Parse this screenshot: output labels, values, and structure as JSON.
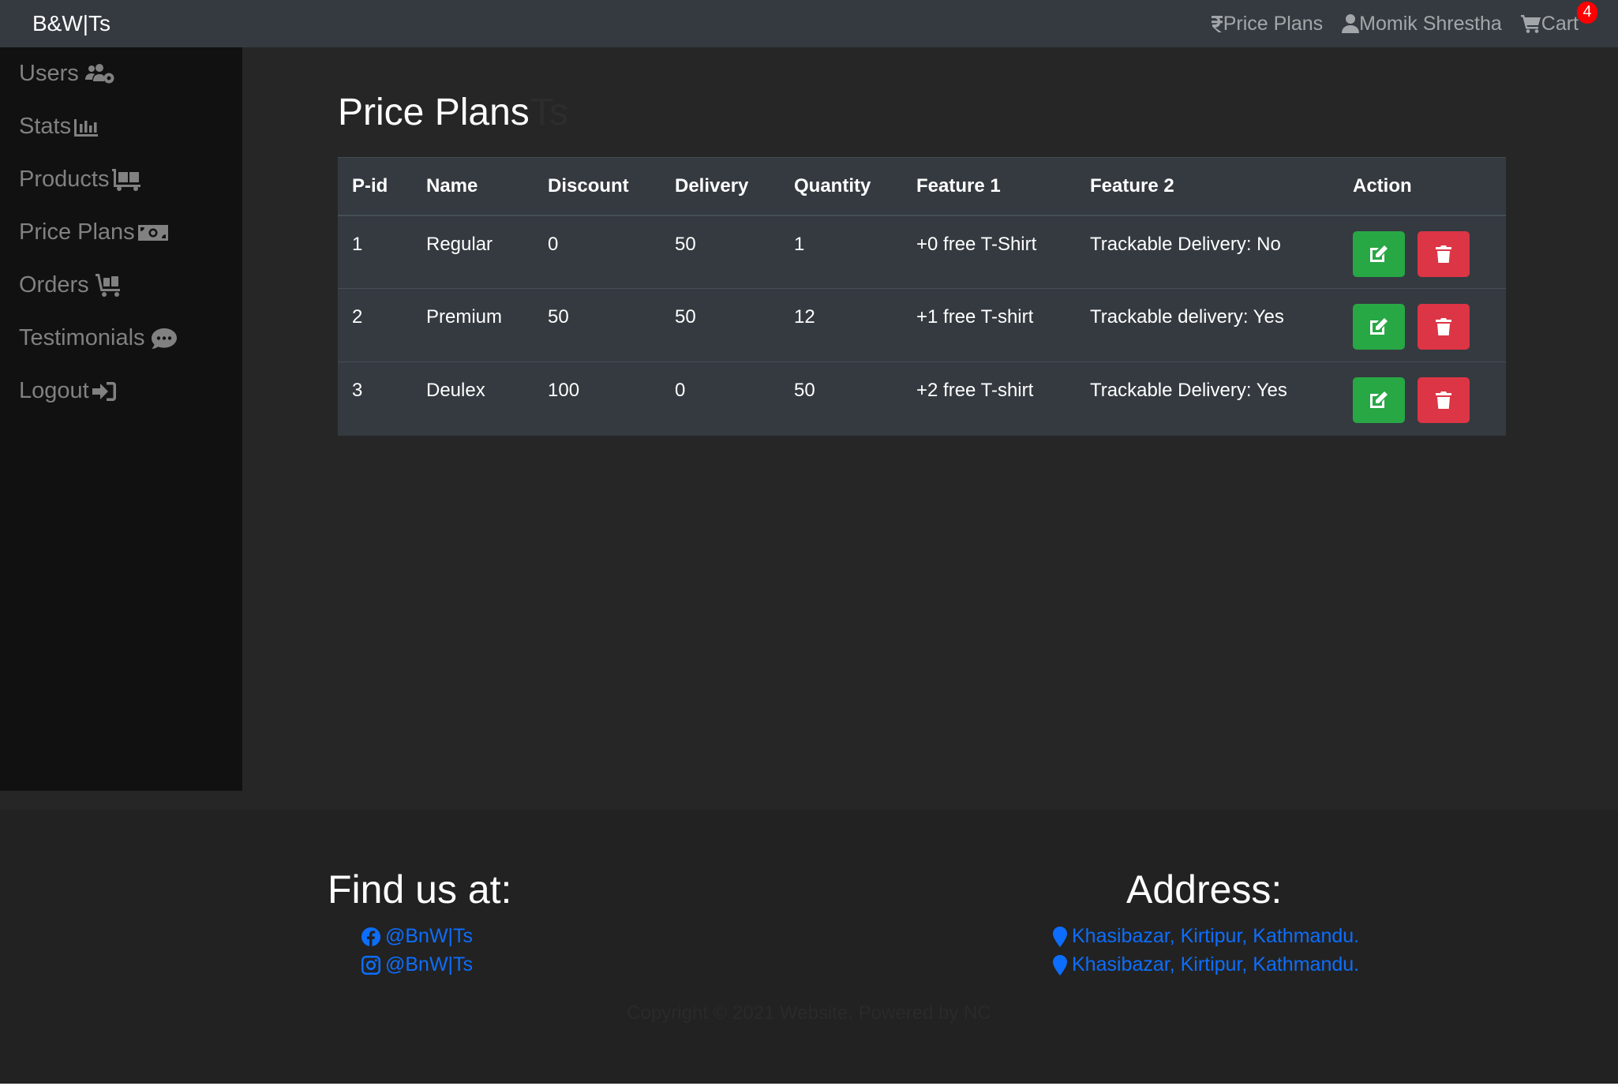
{
  "navbar": {
    "brand": "B&W|Ts",
    "links": {
      "price_plans": "Price Plans",
      "user": "Momik Shrestha",
      "cart": "Cart",
      "cart_count": "4"
    }
  },
  "sidebar": {
    "items": [
      {
        "label": "Users",
        "icon": "users-cog-icon"
      },
      {
        "label": "Stats",
        "icon": "chart-bar-icon"
      },
      {
        "label": "Products",
        "icon": "dolly-flatbed-icon"
      },
      {
        "label": "Price Plans",
        "icon": "money-bill-icon"
      },
      {
        "label": "Orders",
        "icon": "cart-flatbed-icon"
      },
      {
        "label": "Testimonials",
        "icon": "comment-dots-icon"
      },
      {
        "label": "Logout",
        "icon": "sign-out-icon"
      }
    ]
  },
  "main": {
    "title": "Price Plans",
    "ghost_text": "Ts",
    "table": {
      "headers": [
        "P-id",
        "Name",
        "Discount",
        "Delivery",
        "Quantity",
        "Feature 1",
        "Feature 2",
        "Action"
      ],
      "rows": [
        [
          "1",
          "Regular",
          "0",
          "50",
          "1",
          "+0 free T-Shirt",
          "Trackable Delivery: No"
        ],
        [
          "2",
          "Premium",
          "50",
          "50",
          "12",
          "+1 free T-shirt",
          "Trackable delivery: Yes"
        ],
        [
          "3",
          "Deulex",
          "100",
          "0",
          "50",
          "+2 free T-shirt",
          "Trackable Delivery: Yes"
        ]
      ]
    }
  },
  "footer": {
    "find_title": "Find us at:",
    "facebook": "@BnW|Ts",
    "instagram": "@BnW|Ts",
    "address_title": "Address:",
    "address_1": "Khasibazar, Kirtipur, Kathmandu.",
    "address_2": "Khasibazar, Kirtipur, Kathmandu.",
    "copyright": "Copyright © 2021 Website. Powered by NC"
  },
  "colors": {
    "edit": "#28a745",
    "delete": "#dc3545",
    "link": "#0d6efd",
    "badge": "#ff0000"
  }
}
